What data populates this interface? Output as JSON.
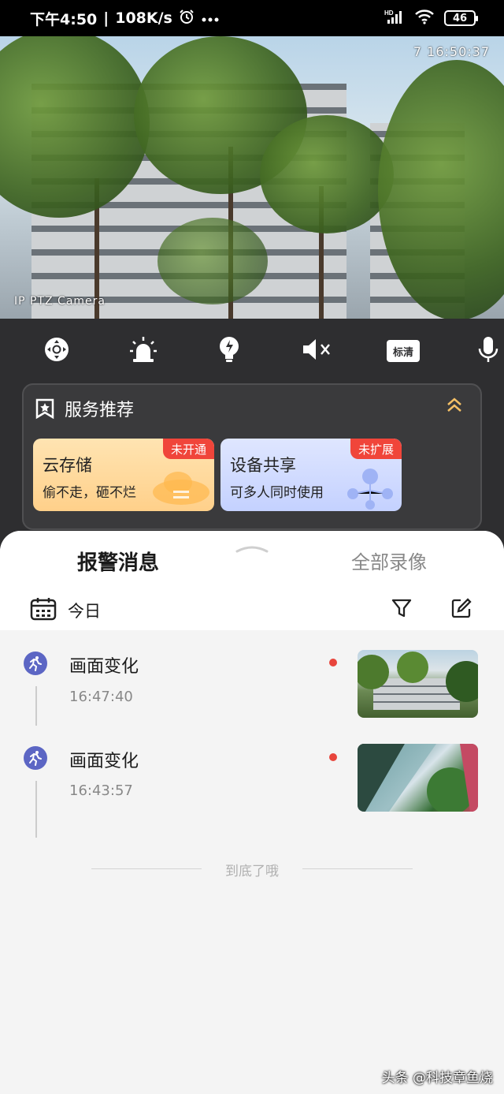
{
  "status_bar": {
    "time": "下午4:50",
    "speed": "108K/s",
    "battery": "46",
    "icons": [
      "alarm-clock-icon",
      "more-dots-icon",
      "hd-signal-icon",
      "wifi-icon",
      "battery-icon"
    ]
  },
  "video": {
    "timestamp": "7 16:50:37",
    "camera_label": "IP PTZ Camera"
  },
  "controls": {
    "buttons": [
      "ptz-icon",
      "alarm-siren-icon",
      "light-bulb-icon",
      "mute-icon",
      "quality-button",
      "mic-icon"
    ],
    "quality_label": "标清"
  },
  "service": {
    "title": "服务推荐",
    "cards": [
      {
        "title": "云存储",
        "subtitle": "偷不走，砸不烂",
        "tag": "未开通"
      },
      {
        "title": "设备共享",
        "subtitle": "可多人同时使用",
        "tag": "未扩展"
      }
    ]
  },
  "sheet": {
    "tab_alarm": "报警消息",
    "tab_recordings": "全部录像",
    "date_label": "今日"
  },
  "events": [
    {
      "title": "画面变化",
      "time": "16:47:40",
      "unread": true
    },
    {
      "title": "画面变化",
      "time": "16:43:57",
      "unread": true
    }
  ],
  "end_text": "到底了哦",
  "watermark": "头条 @科技章鱼烧",
  "colors": {
    "accent_event": "#5c66c4",
    "unread_dot": "#e8453c",
    "tag_red": "#f0453a",
    "panel_dark": "#2e2e30"
  }
}
